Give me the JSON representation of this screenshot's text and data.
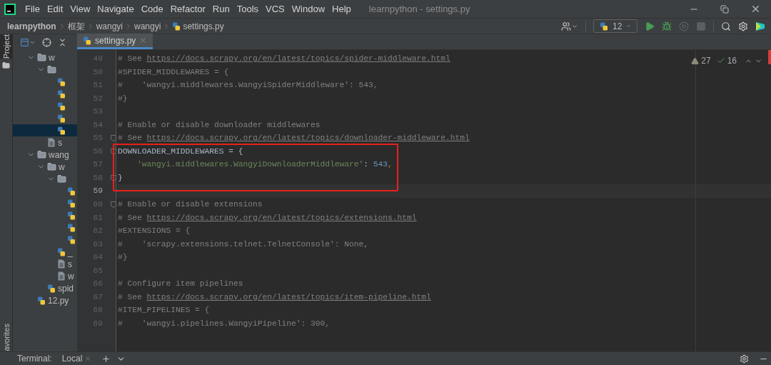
{
  "menu": [
    "File",
    "Edit",
    "View",
    "Navigate",
    "Code",
    "Refactor",
    "Run",
    "Tools",
    "VCS",
    "Window",
    "Help"
  ],
  "window": {
    "title": "learnpython - settings.py"
  },
  "breadcrumbs": [
    {
      "label": "learnpython",
      "kind": "project"
    },
    {
      "label": "框架",
      "kind": "folder"
    },
    {
      "label": "wangyi",
      "kind": "folder"
    },
    {
      "label": "wangyi",
      "kind": "folder"
    },
    {
      "label": "settings.py",
      "kind": "python"
    }
  ],
  "run_config": {
    "label": "12"
  },
  "toolbar": [
    {
      "kind": "run",
      "disabled": false
    },
    {
      "kind": "debug",
      "disabled": false
    },
    {
      "kind": "coverage",
      "disabled": true
    },
    {
      "kind": "stop",
      "disabled": true
    }
  ],
  "side_tabs": [
    {
      "label": "Project",
      "selected": true
    },
    {
      "label": "avorites",
      "selected": false
    }
  ],
  "project_tree": [
    {
      "kind": "folder",
      "label": "w",
      "expanded": true,
      "selected": false,
      "children": [
        {
          "kind": "folder",
          "expanded": true,
          "selected": false,
          "children": [
            {
              "kind": "python",
              "selected": false
            },
            {
              "kind": "python",
              "selected": false
            },
            {
              "kind": "python",
              "selected": false
            },
            {
              "kind": "python",
              "selected": false
            },
            {
              "kind": "python",
              "selected": true
            }
          ]
        },
        {
          "kind": "text",
          "label": "s",
          "selected": false
        }
      ]
    },
    {
      "kind": "folder",
      "label": "wang",
      "expanded": true,
      "selected": false,
      "children": [
        {
          "kind": "folder",
          "label": "w",
          "expanded": true,
          "selected": false,
          "children": [
            {
              "kind": "folder",
              "expanded": true,
              "selected": false,
              "children": [
                {
                  "kind": "python",
                  "selected": false
                },
                {
                  "kind": "python",
                  "selected": false
                },
                {
                  "kind": "python",
                  "selected": false
                },
                {
                  "kind": "python",
                  "selected": false
                },
                {
                  "kind": "python",
                  "selected": false
                }
              ]
            },
            {
              "kind": "python",
              "label": "_",
              "selected": false
            },
            {
              "kind": "text",
              "label": "s",
              "selected": false
            },
            {
              "kind": "text",
              "label": "w",
              "selected": false
            }
          ]
        },
        {
          "kind": "python",
          "label": "spid",
          "selected": false
        }
      ]
    },
    {
      "kind": "python",
      "label": "12.py",
      "selected": false
    }
  ],
  "tabs": [
    {
      "label": "settings.py",
      "selected": true
    }
  ],
  "inspections": {
    "warnings": "27",
    "weak_warnings": "16"
  },
  "code": [
    {
      "number": "49",
      "segments": [
        {
          "kind": "comment",
          "text": "# See "
        },
        {
          "kind": "link",
          "text": "https://docs.scrapy.org/en/latest/topics/spider-middleware.html"
        }
      ]
    },
    {
      "number": "50",
      "segments": [
        {
          "kind": "comment",
          "text": "#SPIDER_MIDDLEWARES = {"
        }
      ]
    },
    {
      "number": "51",
      "segments": [
        {
          "kind": "comment",
          "text": "#    'wangyi.middlewares.WangyiSpiderMiddleware': 543,"
        }
      ]
    },
    {
      "number": "52",
      "segments": [
        {
          "kind": "comment",
          "text": "#}"
        }
      ]
    },
    {
      "number": "53"
    },
    {
      "number": "54",
      "segments": [
        {
          "kind": "comment",
          "text": "# Enable or disable downloader middlewares"
        }
      ]
    },
    {
      "number": "55",
      "fold": true,
      "segments": [
        {
          "kind": "comment",
          "text": "# See "
        },
        {
          "kind": "link",
          "text": "https://docs.scrapy.org/en/latest/topics/downloader-middleware.html"
        }
      ]
    },
    {
      "number": "56",
      "fold": true,
      "boxed": true,
      "segments": [
        {
          "kind": "plain",
          "text": "DOWNLOADER_MIDDLEWARES = {"
        }
      ]
    },
    {
      "number": "57",
      "boxed": true,
      "segments": [
        {
          "kind": "string",
          "text": "    'wangyi.middlewares.WangyiDownloaderMiddleware'"
        },
        {
          "kind": "plain",
          "text": ": "
        },
        {
          "kind": "number",
          "text": "543"
        },
        {
          "kind": "punct",
          "text": ","
        }
      ]
    },
    {
      "number": "58",
      "fold": true,
      "boxed": true,
      "segments": [
        {
          "kind": "plain",
          "text": "}"
        }
      ]
    },
    {
      "number": "59",
      "current": true
    },
    {
      "number": "60",
      "fold": true,
      "segments": [
        {
          "kind": "comment",
          "text": "# Enable or disable extensions"
        }
      ]
    },
    {
      "number": "61",
      "segments": [
        {
          "kind": "comment",
          "text": "# See "
        },
        {
          "kind": "link",
          "text": "https://docs.scrapy.org/en/latest/topics/extensions.html"
        }
      ]
    },
    {
      "number": "62",
      "segments": [
        {
          "kind": "comment",
          "text": "#EXTENSIONS = {"
        }
      ]
    },
    {
      "number": "63",
      "segments": [
        {
          "kind": "comment",
          "text": "#    'scrapy.extensions.telnet.TelnetConsole': None,"
        }
      ]
    },
    {
      "number": "64",
      "segments": [
        {
          "kind": "comment",
          "text": "#}"
        }
      ]
    },
    {
      "number": "65"
    },
    {
      "number": "66",
      "segments": [
        {
          "kind": "comment",
          "text": "# Configure item pipelines"
        }
      ]
    },
    {
      "number": "67",
      "segments": [
        {
          "kind": "comment",
          "text": "# See "
        },
        {
          "kind": "link",
          "text": "https://docs.scrapy.org/en/latest/topics/item-pipeline.html"
        }
      ]
    },
    {
      "number": "68",
      "segments": [
        {
          "kind": "comment",
          "text": "#ITEM_PIPELINES = {"
        }
      ]
    },
    {
      "number": "69",
      "segments": [
        {
          "kind": "comment",
          "text": "#    'wangyi.pipelines.WangyiPipeline': 300,"
        }
      ]
    }
  ],
  "bottom_bar": {
    "label": "Terminal:",
    "tabs": [
      {
        "label": "Local",
        "selected": true
      }
    ]
  }
}
